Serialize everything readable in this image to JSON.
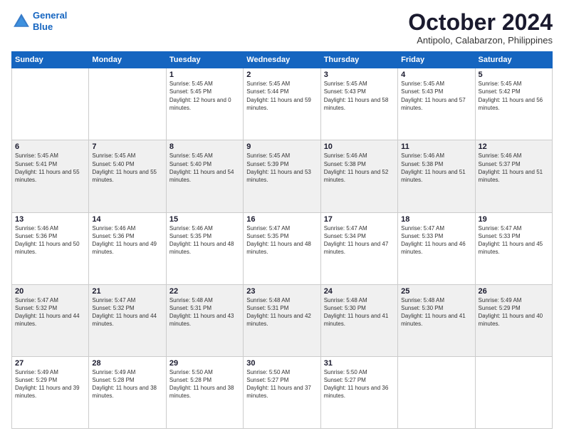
{
  "logo": {
    "line1": "General",
    "line2": "Blue"
  },
  "title": "October 2024",
  "subtitle": "Antipolo, Calabarzon, Philippines",
  "days_of_week": [
    "Sunday",
    "Monday",
    "Tuesday",
    "Wednesday",
    "Thursday",
    "Friday",
    "Saturday"
  ],
  "weeks": [
    [
      {
        "day": "",
        "sunrise": "",
        "sunset": "",
        "daylight": ""
      },
      {
        "day": "",
        "sunrise": "",
        "sunset": "",
        "daylight": ""
      },
      {
        "day": "1",
        "sunrise": "Sunrise: 5:45 AM",
        "sunset": "Sunset: 5:45 PM",
        "daylight": "Daylight: 12 hours and 0 minutes."
      },
      {
        "day": "2",
        "sunrise": "Sunrise: 5:45 AM",
        "sunset": "Sunset: 5:44 PM",
        "daylight": "Daylight: 11 hours and 59 minutes."
      },
      {
        "day": "3",
        "sunrise": "Sunrise: 5:45 AM",
        "sunset": "Sunset: 5:43 PM",
        "daylight": "Daylight: 11 hours and 58 minutes."
      },
      {
        "day": "4",
        "sunrise": "Sunrise: 5:45 AM",
        "sunset": "Sunset: 5:43 PM",
        "daylight": "Daylight: 11 hours and 57 minutes."
      },
      {
        "day": "5",
        "sunrise": "Sunrise: 5:45 AM",
        "sunset": "Sunset: 5:42 PM",
        "daylight": "Daylight: 11 hours and 56 minutes."
      }
    ],
    [
      {
        "day": "6",
        "sunrise": "Sunrise: 5:45 AM",
        "sunset": "Sunset: 5:41 PM",
        "daylight": "Daylight: 11 hours and 55 minutes."
      },
      {
        "day": "7",
        "sunrise": "Sunrise: 5:45 AM",
        "sunset": "Sunset: 5:40 PM",
        "daylight": "Daylight: 11 hours and 55 minutes."
      },
      {
        "day": "8",
        "sunrise": "Sunrise: 5:45 AM",
        "sunset": "Sunset: 5:40 PM",
        "daylight": "Daylight: 11 hours and 54 minutes."
      },
      {
        "day": "9",
        "sunrise": "Sunrise: 5:45 AM",
        "sunset": "Sunset: 5:39 PM",
        "daylight": "Daylight: 11 hours and 53 minutes."
      },
      {
        "day": "10",
        "sunrise": "Sunrise: 5:46 AM",
        "sunset": "Sunset: 5:38 PM",
        "daylight": "Daylight: 11 hours and 52 minutes."
      },
      {
        "day": "11",
        "sunrise": "Sunrise: 5:46 AM",
        "sunset": "Sunset: 5:38 PM",
        "daylight": "Daylight: 11 hours and 51 minutes."
      },
      {
        "day": "12",
        "sunrise": "Sunrise: 5:46 AM",
        "sunset": "Sunset: 5:37 PM",
        "daylight": "Daylight: 11 hours and 51 minutes."
      }
    ],
    [
      {
        "day": "13",
        "sunrise": "Sunrise: 5:46 AM",
        "sunset": "Sunset: 5:36 PM",
        "daylight": "Daylight: 11 hours and 50 minutes."
      },
      {
        "day": "14",
        "sunrise": "Sunrise: 5:46 AM",
        "sunset": "Sunset: 5:36 PM",
        "daylight": "Daylight: 11 hours and 49 minutes."
      },
      {
        "day": "15",
        "sunrise": "Sunrise: 5:46 AM",
        "sunset": "Sunset: 5:35 PM",
        "daylight": "Daylight: 11 hours and 48 minutes."
      },
      {
        "day": "16",
        "sunrise": "Sunrise: 5:47 AM",
        "sunset": "Sunset: 5:35 PM",
        "daylight": "Daylight: 11 hours and 48 minutes."
      },
      {
        "day": "17",
        "sunrise": "Sunrise: 5:47 AM",
        "sunset": "Sunset: 5:34 PM",
        "daylight": "Daylight: 11 hours and 47 minutes."
      },
      {
        "day": "18",
        "sunrise": "Sunrise: 5:47 AM",
        "sunset": "Sunset: 5:33 PM",
        "daylight": "Daylight: 11 hours and 46 minutes."
      },
      {
        "day": "19",
        "sunrise": "Sunrise: 5:47 AM",
        "sunset": "Sunset: 5:33 PM",
        "daylight": "Daylight: 11 hours and 45 minutes."
      }
    ],
    [
      {
        "day": "20",
        "sunrise": "Sunrise: 5:47 AM",
        "sunset": "Sunset: 5:32 PM",
        "daylight": "Daylight: 11 hours and 44 minutes."
      },
      {
        "day": "21",
        "sunrise": "Sunrise: 5:47 AM",
        "sunset": "Sunset: 5:32 PM",
        "daylight": "Daylight: 11 hours and 44 minutes."
      },
      {
        "day": "22",
        "sunrise": "Sunrise: 5:48 AM",
        "sunset": "Sunset: 5:31 PM",
        "daylight": "Daylight: 11 hours and 43 minutes."
      },
      {
        "day": "23",
        "sunrise": "Sunrise: 5:48 AM",
        "sunset": "Sunset: 5:31 PM",
        "daylight": "Daylight: 11 hours and 42 minutes."
      },
      {
        "day": "24",
        "sunrise": "Sunrise: 5:48 AM",
        "sunset": "Sunset: 5:30 PM",
        "daylight": "Daylight: 11 hours and 41 minutes."
      },
      {
        "day": "25",
        "sunrise": "Sunrise: 5:48 AM",
        "sunset": "Sunset: 5:30 PM",
        "daylight": "Daylight: 11 hours and 41 minutes."
      },
      {
        "day": "26",
        "sunrise": "Sunrise: 5:49 AM",
        "sunset": "Sunset: 5:29 PM",
        "daylight": "Daylight: 11 hours and 40 minutes."
      }
    ],
    [
      {
        "day": "27",
        "sunrise": "Sunrise: 5:49 AM",
        "sunset": "Sunset: 5:29 PM",
        "daylight": "Daylight: 11 hours and 39 minutes."
      },
      {
        "day": "28",
        "sunrise": "Sunrise: 5:49 AM",
        "sunset": "Sunset: 5:28 PM",
        "daylight": "Daylight: 11 hours and 38 minutes."
      },
      {
        "day": "29",
        "sunrise": "Sunrise: 5:50 AM",
        "sunset": "Sunset: 5:28 PM",
        "daylight": "Daylight: 11 hours and 38 minutes."
      },
      {
        "day": "30",
        "sunrise": "Sunrise: 5:50 AM",
        "sunset": "Sunset: 5:27 PM",
        "daylight": "Daylight: 11 hours and 37 minutes."
      },
      {
        "day": "31",
        "sunrise": "Sunrise: 5:50 AM",
        "sunset": "Sunset: 5:27 PM",
        "daylight": "Daylight: 11 hours and 36 minutes."
      },
      {
        "day": "",
        "sunrise": "",
        "sunset": "",
        "daylight": ""
      },
      {
        "day": "",
        "sunrise": "",
        "sunset": "",
        "daylight": ""
      }
    ]
  ]
}
